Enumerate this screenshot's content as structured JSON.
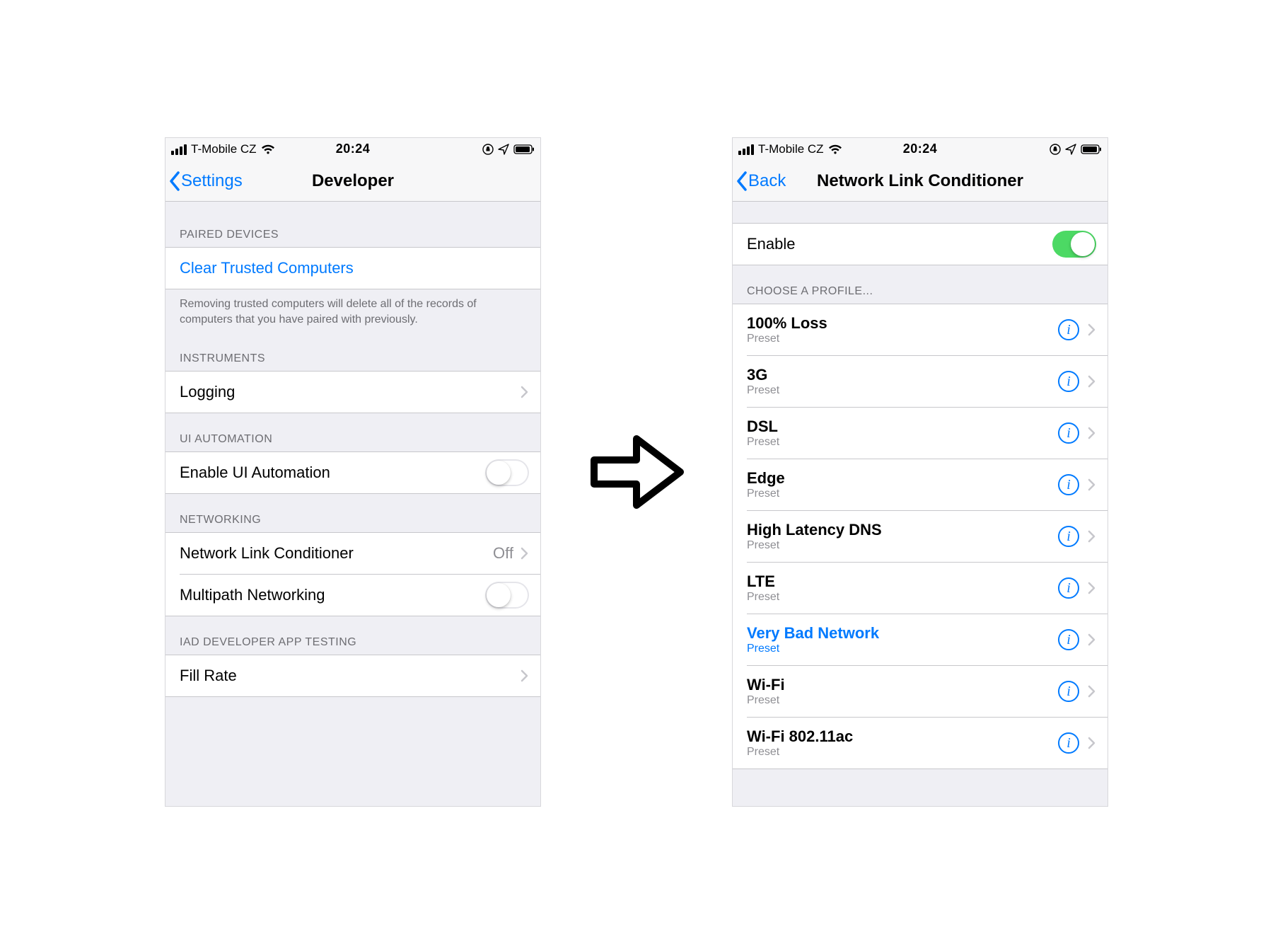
{
  "status": {
    "carrier": "T-Mobile CZ",
    "time": "20:24"
  },
  "left": {
    "back_label": "Settings",
    "title": "Developer",
    "paired_header": "PAIRED DEVICES",
    "clear_trusted": "Clear Trusted Computers",
    "paired_footer": "Removing trusted computers will delete all of the records of computers that you have paired with previously.",
    "instruments_header": "INSTRUMENTS",
    "logging": "Logging",
    "ui_auto_header": "UI AUTOMATION",
    "enable_ui": "Enable UI Automation",
    "networking_header": "NETWORKING",
    "nlc_label": "Network Link Conditioner",
    "nlc_value": "Off",
    "multipath": "Multipath Networking",
    "iad_header": "IAD DEVELOPER APP TESTING",
    "fill_rate": "Fill Rate"
  },
  "right": {
    "back_label": "Back",
    "title": "Network Link Conditioner",
    "enable_label": "Enable",
    "choose_header": "CHOOSE A PROFILE...",
    "preset_label": "Preset",
    "profiles": [
      {
        "name": "100% Loss",
        "selected": false
      },
      {
        "name": "3G",
        "selected": false
      },
      {
        "name": "DSL",
        "selected": false
      },
      {
        "name": "Edge",
        "selected": false
      },
      {
        "name": "High Latency DNS",
        "selected": false
      },
      {
        "name": "LTE",
        "selected": false
      },
      {
        "name": "Very Bad Network",
        "selected": true
      },
      {
        "name": "Wi-Fi",
        "selected": false
      },
      {
        "name": "Wi-Fi 802.11ac",
        "selected": false
      }
    ]
  }
}
